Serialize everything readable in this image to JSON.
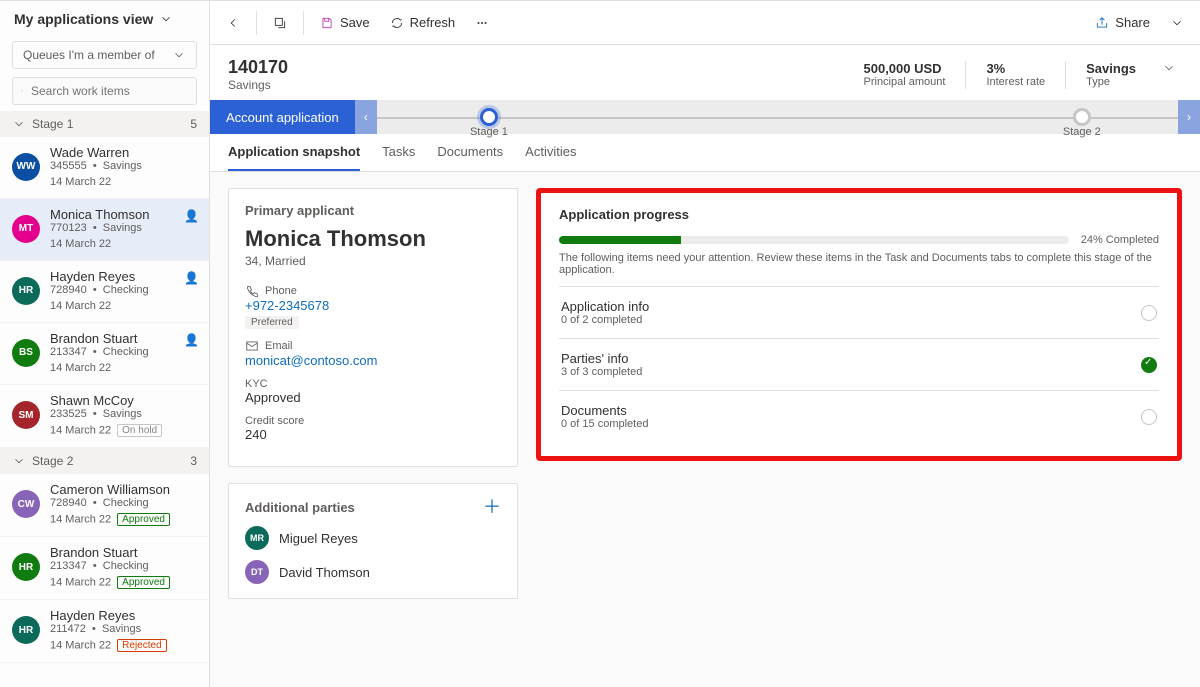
{
  "sidebar": {
    "view_title": "My applications view",
    "queue_select": "Queues I'm a member of",
    "search_placeholder": "Search work items",
    "stages": [
      {
        "label": "Stage 1",
        "count": "5"
      },
      {
        "label": "Stage 2",
        "count": "3"
      }
    ],
    "stage1_items": [
      {
        "name": "Wade Warren",
        "code": "345555",
        "type": "Savings",
        "date": "14 March 22",
        "initials": "WW",
        "color": "#0b4ea2",
        "presence": false,
        "selected": false,
        "badge": null
      },
      {
        "name": "Monica Thomson",
        "code": "770123",
        "type": "Savings",
        "date": "14 March 22",
        "initials": "MT",
        "color": "#e3008c",
        "presence": true,
        "selected": true,
        "badge": null
      },
      {
        "name": "Hayden Reyes",
        "code": "728940",
        "type": "Checking",
        "date": "14 March 22",
        "initials": "HR",
        "color": "#0b6a5a",
        "presence": true,
        "selected": false,
        "badge": null
      },
      {
        "name": "Brandon Stuart",
        "code": "213347",
        "type": "Checking",
        "date": "14 March 22",
        "initials": "BS",
        "color": "#107c10",
        "presence": true,
        "selected": false,
        "badge": null
      },
      {
        "name": "Shawn McCoy",
        "code": "233525",
        "type": "Savings",
        "date": "14 March 22",
        "initials": "SM",
        "color": "#a4262c",
        "presence": false,
        "selected": false,
        "badge": "On hold"
      }
    ],
    "stage2_items": [
      {
        "name": "Cameron Williamson",
        "code": "728940",
        "type": "Checking",
        "date": "14 March 22",
        "initials": "CW",
        "color": "#8764b8",
        "presence": false,
        "selected": false,
        "badge": "Approved"
      },
      {
        "name": "Brandon Stuart",
        "code": "213347",
        "type": "Checking",
        "date": "14 March 22",
        "initials": "HR",
        "color": "#107c10",
        "presence": false,
        "selected": false,
        "badge": "Approved"
      },
      {
        "name": "Hayden Reyes",
        "code": "211472",
        "type": "Savings",
        "date": "14 March 22",
        "initials": "HR",
        "color": "#0b6a5a",
        "presence": false,
        "selected": false,
        "badge": "Rejected"
      }
    ]
  },
  "cmdbar": {
    "save": "Save",
    "refresh": "Refresh",
    "share": "Share"
  },
  "record_header": {
    "number": "140170",
    "subtitle": "Savings",
    "amount": "500,000 USD",
    "amount_label": "Principal amount",
    "rate": "3%",
    "rate_label": "Interest rate",
    "type": "Savings",
    "type_label": "Type"
  },
  "stagebar": {
    "current": "Account application",
    "nodes": [
      "Stage 1",
      "Stage 2"
    ]
  },
  "tabs": [
    "Application snapshot",
    "Tasks",
    "Documents",
    "Activities"
  ],
  "primary": {
    "header": "Primary applicant",
    "name": "Monica Thomson",
    "meta": "34, Married",
    "phone_label": "Phone",
    "phone": "+972-2345678",
    "phone_tag": "Preferred",
    "email_label": "Email",
    "email": "monicat@contoso.com",
    "kyc_label": "KYC",
    "kyc": "Approved",
    "score_label": "Credit score",
    "score": "240"
  },
  "parties": {
    "header": "Additional parties",
    "list": [
      {
        "name": "Miguel Reyes",
        "initials": "MR",
        "color": "#0b6a5a"
      },
      {
        "name": "David Thomson",
        "initials": "DT",
        "color": "#8764b8"
      }
    ]
  },
  "progress": {
    "header": "Application progress",
    "percent": 24,
    "percent_text": "24% Completed",
    "note": "The following items need your attention. Review these items in the Task and Documents tabs to complete this stage of the application.",
    "sections": [
      {
        "title": "Application info",
        "sub": "0 of 2 completed",
        "done": false
      },
      {
        "title": "Parties' info",
        "sub": "3 of 3 completed",
        "done": true
      },
      {
        "title": "Documents",
        "sub": "0 of 15 completed",
        "done": false
      }
    ]
  }
}
